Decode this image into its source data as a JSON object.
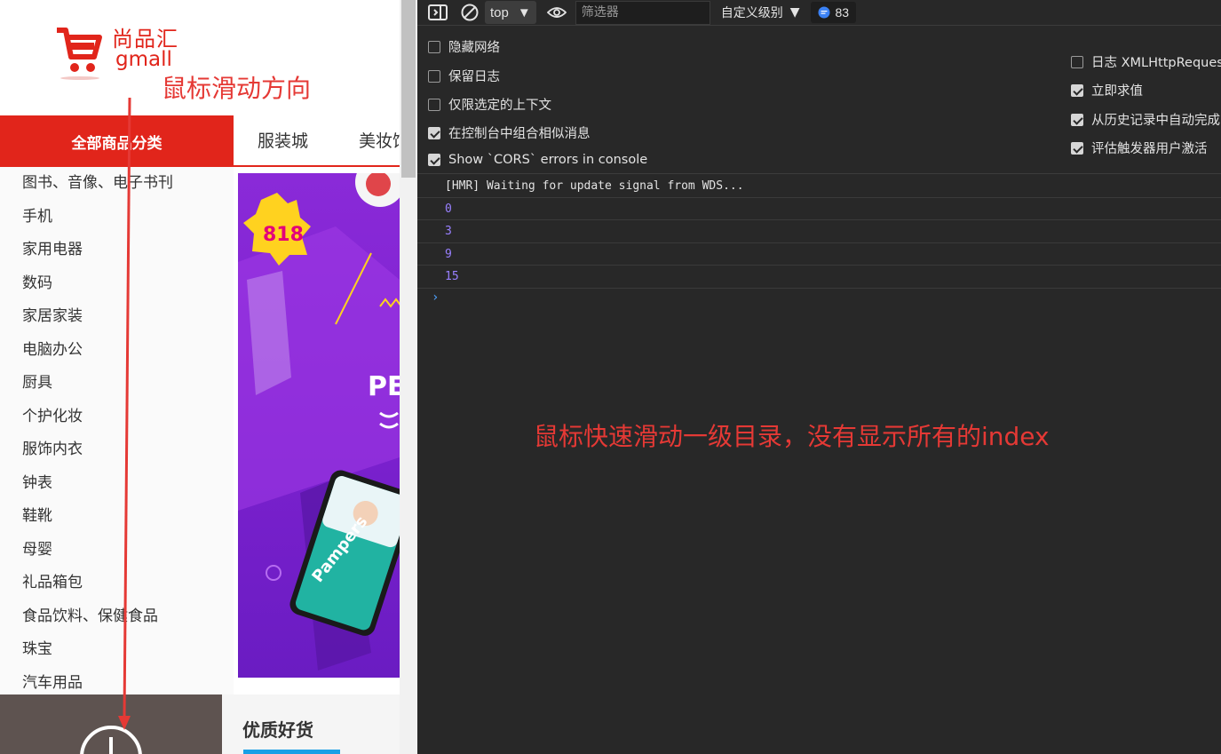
{
  "shop": {
    "logo_cn": "尚品汇",
    "logo_en": "gmall",
    "annotation_scroll": "鼠标滑动方向",
    "all_categories": "全部商品分类",
    "nav_links": [
      "服装城",
      "美妆馆"
    ],
    "categories": [
      "图书、音像、电子书刊",
      "手机",
      "家用电器",
      "数码",
      "家居家装",
      "电脑办公",
      "厨具",
      "个护化妆",
      "服饰内衣",
      "钟表",
      "鞋靴",
      "母婴",
      "礼品箱包",
      "食品饮料、保健食品",
      "珠宝",
      "汽车用品"
    ],
    "quality_goods": "优质好货"
  },
  "devtools": {
    "context": "top",
    "filter_placeholder": "筛选器",
    "level": "自定义级别",
    "issues_count": "83",
    "options_left": [
      {
        "label": "隐藏网络",
        "checked": false
      },
      {
        "label": "保留日志",
        "checked": false
      },
      {
        "label": "仅限选定的上下文",
        "checked": false
      },
      {
        "label": "在控制台中组合相似消息",
        "checked": true
      },
      {
        "label": "Show `CORS` errors in console",
        "checked": true
      }
    ],
    "options_right": [
      {
        "label": "日志 XMLHttpRequest",
        "checked": false
      },
      {
        "label": "立即求值",
        "checked": true
      },
      {
        "label": "从历史记录中自动完成",
        "checked": true
      },
      {
        "label": "评估触发器用户激活",
        "checked": true
      }
    ],
    "logs": [
      {
        "text": "[HMR] Waiting for update signal from WDS...",
        "kind": "text"
      },
      {
        "text": "0",
        "kind": "num"
      },
      {
        "text": "3",
        "kind": "num"
      },
      {
        "text": "9",
        "kind": "num"
      },
      {
        "text": "15",
        "kind": "num"
      }
    ],
    "annotation_note": "鼠标快速滑动一级目录，没有显示所有的index"
  },
  "colors": {
    "brand_red": "#e1251b",
    "annotation_red": "#e53935",
    "console_bg": "#282828",
    "log_number": "#9980ff"
  }
}
